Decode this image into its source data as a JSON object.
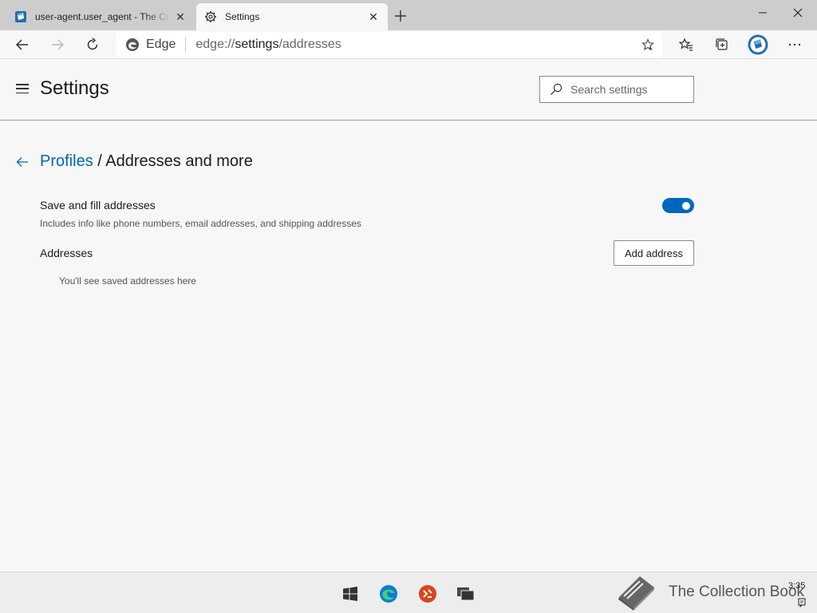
{
  "browser": {
    "tabs": [
      {
        "title": "user-agent.user_agent - The Coll",
        "icon": "collection-book-icon",
        "active": false
      },
      {
        "title": "Settings",
        "icon": "gear-icon",
        "active": true
      }
    ],
    "site_label": "Edge",
    "url_prefix": "edge://",
    "url_host": "settings",
    "url_path": "/addresses"
  },
  "settings": {
    "title": "Settings",
    "search_placeholder": "Search settings"
  },
  "page": {
    "breadcrumb_link": "Profiles",
    "breadcrumb_separator": " / ",
    "breadcrumb_current": "Addresses and more",
    "save_fill": {
      "title": "Save and fill addresses",
      "description": "Includes info like phone numbers, email addresses, and shipping addresses",
      "enabled": true
    },
    "addresses_label": "Addresses",
    "add_button": "Add address",
    "empty_message": "You'll see saved addresses here"
  },
  "taskbar": {
    "watermark_text": "The Collection Book",
    "clock": "3:35"
  },
  "colors": {
    "accent": "#0067b8",
    "toggle_on": "#0067c0",
    "tabstrip": "#cdcdcd",
    "background": "#f7f7f7"
  }
}
